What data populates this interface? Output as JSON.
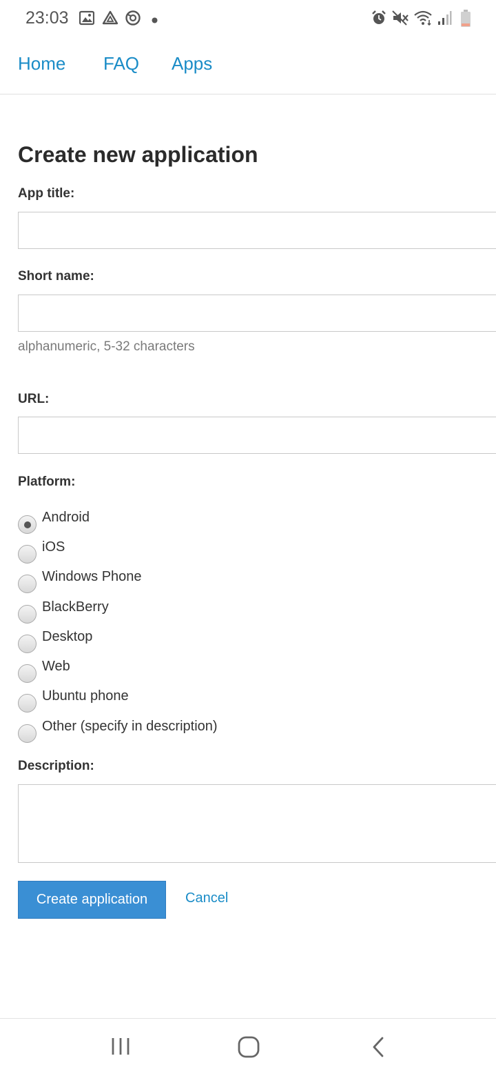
{
  "status_bar": {
    "time": "23:03",
    "left_icons": [
      "image-icon",
      "drive-icon",
      "sync-app-icon",
      "dot-icon"
    ],
    "right_icons": [
      "alarm-icon",
      "mute-icon",
      "wifi-icon",
      "signal-icon",
      "battery-icon"
    ]
  },
  "nav": {
    "home": "Home",
    "faq": "FAQ",
    "apps": "Apps"
  },
  "form": {
    "title": "Create new application",
    "app_title_label": "App title:",
    "app_title_value": "",
    "short_name_label": "Short name:",
    "short_name_value": "",
    "short_name_help": "alphanumeric, 5-32 characters",
    "url_label": "URL:",
    "url_value": "",
    "platform_label": "Platform:",
    "platforms": [
      {
        "label": "Android",
        "checked": true
      },
      {
        "label": "iOS",
        "checked": false
      },
      {
        "label": "Windows Phone",
        "checked": false
      },
      {
        "label": "BlackBerry",
        "checked": false
      },
      {
        "label": "Desktop",
        "checked": false
      },
      {
        "label": "Web",
        "checked": false
      },
      {
        "label": "Ubuntu phone",
        "checked": false
      },
      {
        "label": "Other (specify in description)",
        "checked": false
      }
    ],
    "description_label": "Description:",
    "description_value": "",
    "submit_label": "Create application",
    "cancel_label": "Cancel"
  },
  "colors": {
    "link": "#1a8cc7",
    "primary_button": "#3a8fd4",
    "text": "#333333",
    "help_text": "#7a7a7a"
  },
  "system_nav": [
    "recents-icon",
    "home-icon",
    "back-icon"
  ]
}
